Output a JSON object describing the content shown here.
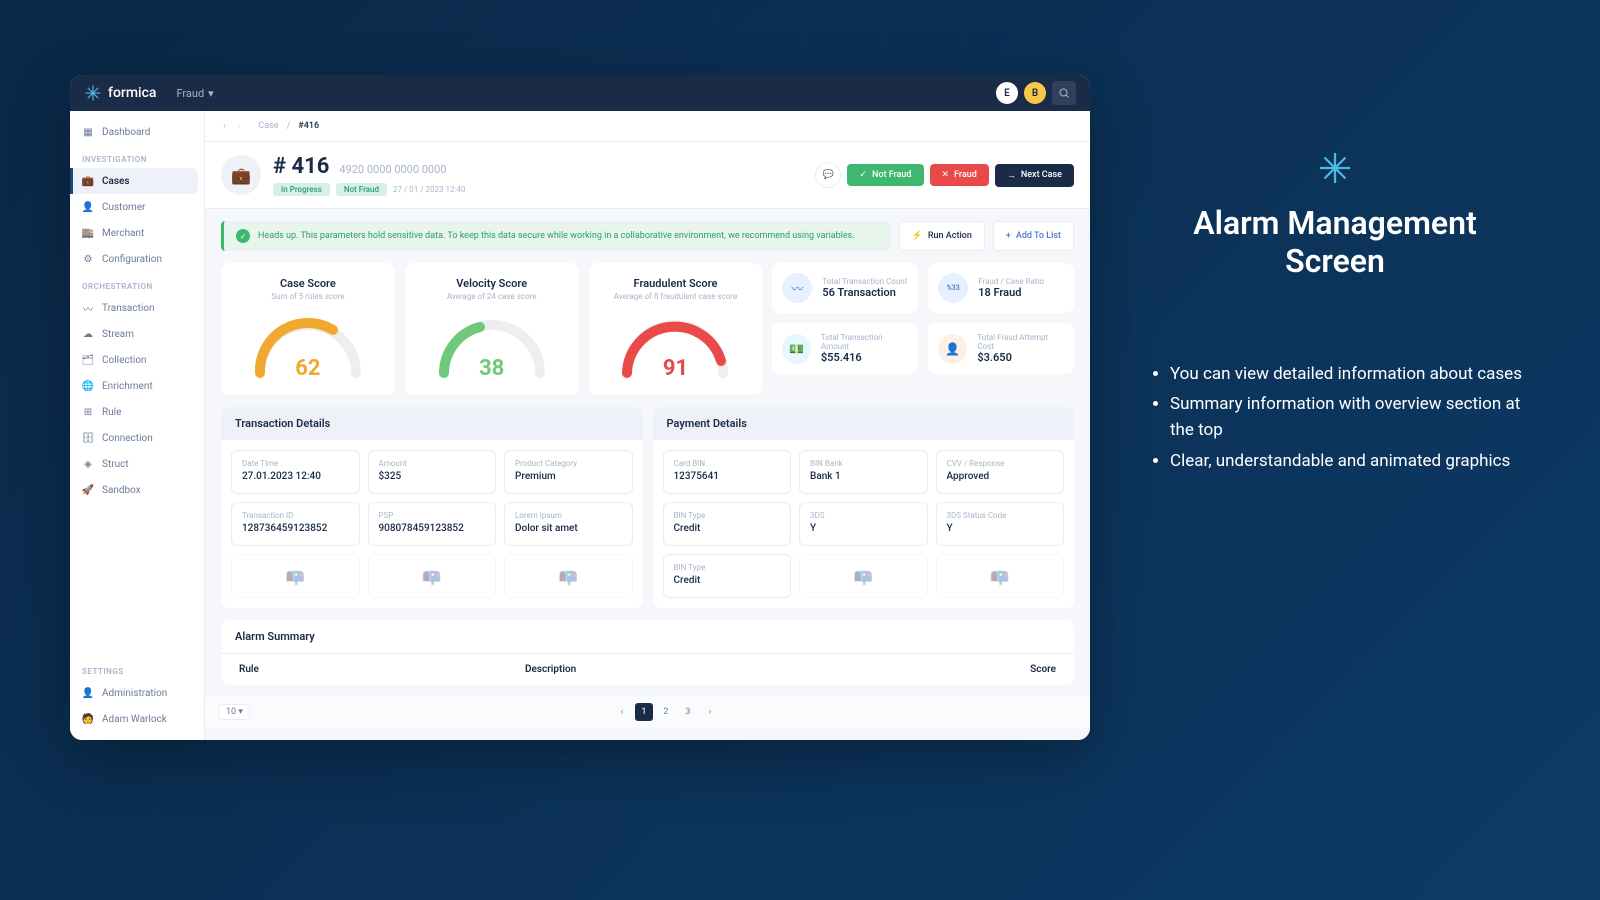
{
  "brand": "formica",
  "top_menu": "Fraud",
  "avatars": {
    "e": "E",
    "b": "B"
  },
  "sidebar": {
    "dashboard": "Dashboard",
    "sections": {
      "investigation": "INVESTIGATION",
      "orchestration": "ORCHESTRATION",
      "settings": "SETTINGS"
    },
    "items": {
      "cases": "Cases",
      "customer": "Customer",
      "merchant": "Merchant",
      "configuration": "Configuration",
      "transaction": "Transaction",
      "stream": "Stream",
      "collection": "Collection",
      "enrichment": "Enrichment",
      "rule": "Rule",
      "connection": "Connection",
      "struct": "Struct",
      "sandbox": "Sandbox",
      "administration": "Administration",
      "user": "Adam Warlock"
    }
  },
  "breadcrumb": {
    "case": "Case",
    "id": "#416",
    "sep": "/"
  },
  "case": {
    "title": "# 416",
    "card": "4920 0000 0000 0000",
    "badge_progress": "In Progress",
    "badge_status": "Not Fraud",
    "date": "27 / 01 / 2023   12:40"
  },
  "actions": {
    "not_fraud": "Not Fraud",
    "fraud": "Fraud",
    "next": "Next Case",
    "run": "Run Action",
    "add": "Add To List"
  },
  "alert": "Heads up. This parameters hold sensitive data. To keep this data secure while working in a collaborative environment, we recommend using variables.",
  "scores": {
    "case": {
      "title": "Case Score",
      "sub": "Sum of 5 rules score",
      "value": "62",
      "color": "#f0a830"
    },
    "velocity": {
      "title": "Velocity Score",
      "sub": "Average of 24 case score",
      "value": "38",
      "color": "#6fc97a"
    },
    "fraud": {
      "title": "Fraudulent Score",
      "sub": "Average of 8 fraudulent case score",
      "value": "91",
      "color": "#e84a4a"
    }
  },
  "stats": {
    "count": {
      "label": "Total Transaction Count",
      "value": "56 Transaction"
    },
    "ratio": {
      "label": "Fraud / Case Ratio",
      "value": "18 Fraud",
      "badge": "%33"
    },
    "amount": {
      "label": "Total Transaction Amount",
      "value": "$55.416"
    },
    "attempt": {
      "label": "Total Fraud Attempt Cost",
      "value": "$3.650"
    }
  },
  "panels": {
    "transaction": {
      "title": "Transaction Details",
      "fields": [
        {
          "label": "Date Time",
          "value": "27.01.2023  12:40"
        },
        {
          "label": "Amount",
          "value": "$325"
        },
        {
          "label": "Product Category",
          "value": "Premium"
        },
        {
          "label": "Transaction ID",
          "value": "128736459123852"
        },
        {
          "label": "PSP",
          "value": "908078459123852"
        },
        {
          "label": "Lorem Ipsum",
          "value": "Dolor sit amet"
        }
      ]
    },
    "payment": {
      "title": "Payment Details",
      "fields": [
        {
          "label": "Card BIN",
          "value": "12375641"
        },
        {
          "label": "BIN Bank",
          "value": "Bank 1"
        },
        {
          "label": "CVV / Response",
          "value": "Approved"
        },
        {
          "label": "BIN Type",
          "value": "Credit"
        },
        {
          "label": "3DS",
          "value": "Y"
        },
        {
          "label": "3DS Status Code",
          "value": "Y"
        },
        {
          "label": "BIN Type",
          "value": "Credit"
        }
      ]
    }
  },
  "alarm": {
    "title": "Alarm Summary",
    "cols": {
      "rule": "Rule",
      "desc": "Description",
      "score": "Score"
    }
  },
  "pagination": {
    "size": "10",
    "pages": [
      "1",
      "2",
      "3"
    ]
  },
  "promo": {
    "title_l1": "Alarm Management",
    "title_l2": "Screen",
    "bullets": [
      "You can view detailed information about cases",
      "Summary information with overview section at the top",
      "Clear, understandable and animated graphics"
    ]
  }
}
